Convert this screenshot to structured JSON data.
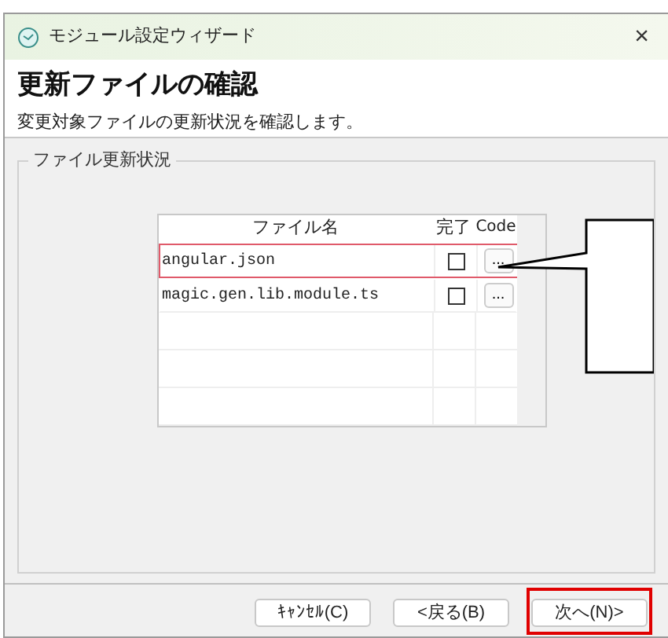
{
  "window": {
    "title": "モジュール設定ウィザード",
    "close": "×"
  },
  "header": {
    "title": "更新ファイルの確認",
    "subtitle": "変更対象ファイルの更新状況を確認します。"
  },
  "group": {
    "label": "ファイル更新状況"
  },
  "table": {
    "columns": [
      "ファイル名",
      "完了",
      "Code"
    ],
    "rows": [
      {
        "file": "angular.json",
        "done": false,
        "code": "...",
        "highlighted": true
      },
      {
        "file": "magic.gen.lib.module.ts",
        "done": false,
        "code": "...",
        "highlighted": false
      }
    ]
  },
  "buttons": [
    {
      "label": "ｷｬﾝｾﾙ(C)",
      "highlighted": false
    },
    {
      "label": "<戻る(B)",
      "highlighted": false
    },
    {
      "label": "次へ(N)>",
      "highlighted": true
    }
  ]
}
